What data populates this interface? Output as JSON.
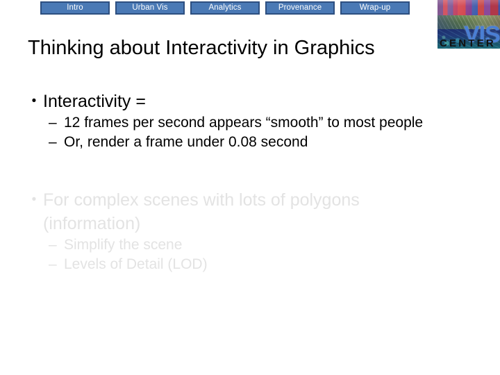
{
  "nav": {
    "tabs": [
      {
        "label": "Intro"
      },
      {
        "label": "Urban Vis"
      },
      {
        "label": "Analytics"
      },
      {
        "label": "Provenance"
      },
      {
        "label": "Wrap-up"
      }
    ],
    "tab_fill_color": "#4a79b5",
    "tab_border_color": "#2d4f80",
    "tab_text_color": "#ffffff"
  },
  "logo": {
    "wordmark": "VIS",
    "subtext": "CENTER",
    "wordmark_color": "#4a7fd4",
    "subtext_color": "#111111"
  },
  "title": "Thinking about Interactivity in Graphics",
  "content": {
    "groups": [
      {
        "dim": false,
        "bullet_marker": "•",
        "bullet_text": "Interactivity =",
        "sub_marker": "–",
        "sub_items": [
          "12 frames per second appears “smooth” to most people",
          "Or, render a frame under 0.08 second"
        ]
      },
      {
        "dim": true,
        "bullet_marker": "•",
        "bullet_text": "For complex scenes with lots of polygons (information)",
        "sub_marker": "–",
        "sub_items": [
          "Simplify the scene",
          "Levels of Detail (LOD)"
        ]
      }
    ],
    "dim_text_color": "#e3e3e3",
    "text_color": "#000000"
  }
}
